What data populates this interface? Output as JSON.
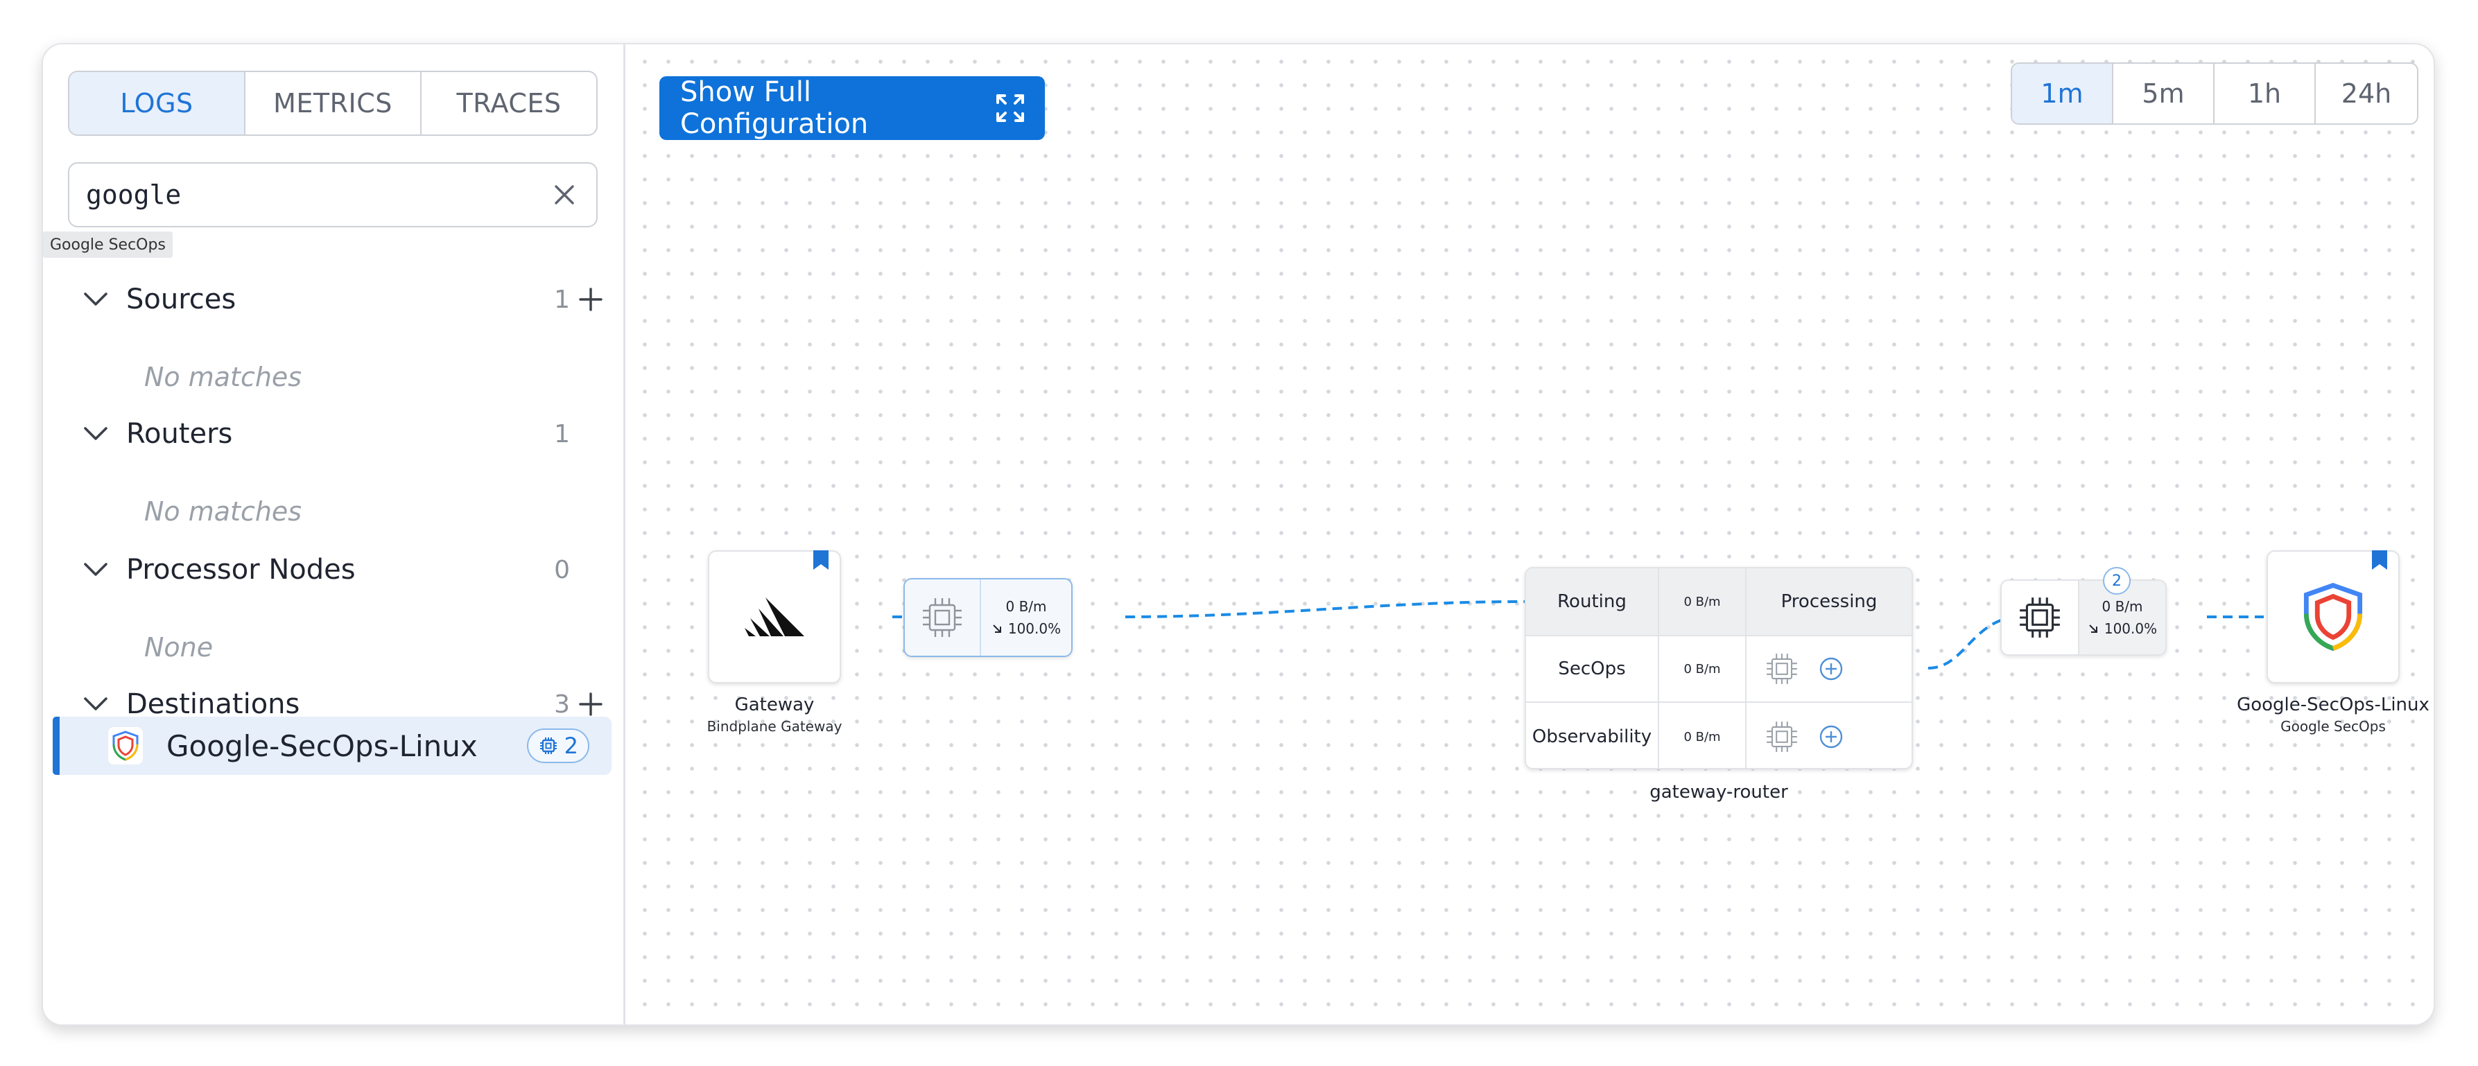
{
  "sidebar": {
    "tabs": [
      {
        "label": "LOGS",
        "active": true
      },
      {
        "label": "METRICS",
        "active": false
      },
      {
        "label": "TRACES",
        "active": false
      }
    ],
    "search": {
      "value": "google",
      "tooltip": "Google SecOps"
    },
    "sections": {
      "sources": {
        "title": "Sources",
        "count": "1",
        "empty": "No matches"
      },
      "routers": {
        "title": "Routers",
        "count": "1",
        "empty": "No matches"
      },
      "processors": {
        "title": "Processor Nodes",
        "count": "0",
        "empty": "None"
      },
      "destinations": {
        "title": "Destinations",
        "count": "3"
      }
    },
    "destination_item": {
      "label": "Google-SecOps-Linux",
      "badge_count": "2"
    }
  },
  "canvas": {
    "show_config_label": "Show Full Configuration",
    "time_ranges": [
      {
        "label": "1m",
        "active": true
      },
      {
        "label": "5m",
        "active": false
      },
      {
        "label": "1h",
        "active": false
      },
      {
        "label": "24h",
        "active": false
      }
    ],
    "source_node": {
      "title": "Gateway",
      "subtitle": "Bindplane Gateway"
    },
    "processor_1": {
      "rate": "0 B/m",
      "ratio": "100.0%"
    },
    "router": {
      "name": "gateway-router",
      "header": {
        "routing": "Routing",
        "rate": "0 B/m",
        "processing": "Processing"
      },
      "routes": [
        {
          "name": "SecOps",
          "rate": "0 B/m"
        },
        {
          "name": "Observability",
          "rate": "0 B/m"
        }
      ]
    },
    "processor_2": {
      "rate": "0 B/m",
      "ratio": "100.0%",
      "badge": "2"
    },
    "destination_node": {
      "title": "Google-SecOps-Linux",
      "subtitle": "Google SecOps"
    }
  },
  "colors": {
    "accent": "#1f74d6",
    "button": "#0e72da",
    "wire": "#1a8be6"
  }
}
